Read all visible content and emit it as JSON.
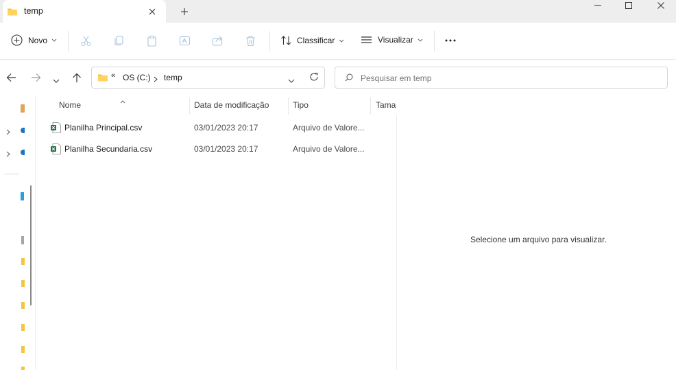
{
  "tab": {
    "title": "temp"
  },
  "toolbar": {
    "new_label": "Novo",
    "sort_label": "Classificar",
    "view_label": "Visualizar"
  },
  "address": {
    "overflow": "«",
    "drive": "OS (C:)",
    "folder": "temp"
  },
  "search": {
    "placeholder": "Pesquisar em temp"
  },
  "columns": [
    "Nome",
    "Data de modificação",
    "Tipo",
    "Taman"
  ],
  "files": [
    {
      "name": "Planilha Principal.csv",
      "modified": "03/01/2023 20:17",
      "type": "Arquivo de Valore..."
    },
    {
      "name": "Planilha Secundaria.csv",
      "modified": "03/01/2023 20:17",
      "type": "Arquivo de Valore..."
    }
  ],
  "preview": {
    "message": "Selecione um arquivo para visualizar."
  },
  "colors": {
    "folder": "#f4c542",
    "excel": "#1f7244",
    "accent": "#0067c0"
  }
}
